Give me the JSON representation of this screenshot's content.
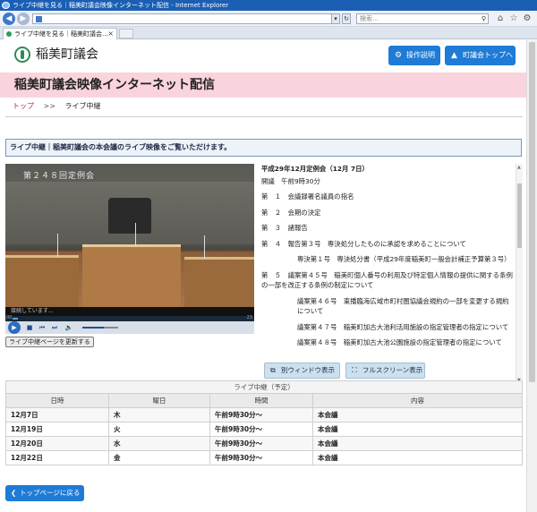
{
  "browser": {
    "title": "ライブ中継を見る｜稲美町議会映像インターネット配信 - Internet Explorer",
    "search_placeholder": "検索...",
    "tab_label": "ライブ中継を見る｜稲美町議会..."
  },
  "header": {
    "site_name": "稲美町議会",
    "help_button": "操作説明",
    "council_top_button": "町議会トップへ"
  },
  "banner": {
    "title": "稲美町議会映像インターネット配信"
  },
  "breadcrumb": {
    "home": "トップ",
    "separator": ">>",
    "current": "ライブ中継"
  },
  "notice": "ライブ中継｜稲美町議会の本会議のライブ映像をご覧いただけます。",
  "player": {
    "caption": "第２４８回定例会",
    "status": "接続しています...",
    "time_left": "00",
    "time_right": "23",
    "volume_level": 0.6,
    "refresh_button": "ライブ中継ページを更新する"
  },
  "agenda": {
    "session_title": "平成29年12月定例会（12月 7日）",
    "opening": "開議　午前9時30分",
    "items": [
      "第　１　会議録署名議員の指名",
      "第　２　会期の決定",
      "第　３　諸報告",
      "第　４　報告第３号　専決処分したものに承認を求めることについて",
      "専決第１号　専決処分書（平成29年度稲美町一般会計補正予算第３号）",
      "第　５　議案第４５号　稲美町個人番号の利用及び特定個人情報の提供に関する条例の一部を改正する条例の制定について",
      "議案第４６号　東播臨海広域市町村圏協議会規約の一部を変更する規約について",
      "議案第４７号　稲美町加古大池利活用施設の指定管理者の指定について",
      "議案第４８号　稲美町加古大池公園施設の指定管理者の指定について"
    ],
    "new_window_button": "別ウィンドウ表示",
    "fullscreen_button": "フルスクリーン表示"
  },
  "schedule": {
    "caption": "ライブ中継（予定）",
    "columns": [
      "日時",
      "曜日",
      "時間",
      "内容"
    ],
    "rows": [
      [
        "12月7日",
        "木",
        "午前9時30分～",
        "本会議"
      ],
      [
        "12月19日",
        "火",
        "午前9時30分～",
        "本会議"
      ],
      [
        "12月20日",
        "水",
        "午前9時30分～",
        "本会議"
      ],
      [
        "12月22日",
        "金",
        "午前9時30分～",
        "本会議"
      ]
    ]
  },
  "footer": {
    "back_to_top": "トップページに戻る"
  },
  "colors": {
    "accent": "#1e7bd6",
    "banner": "#f9d4dc",
    "breadcrumb_link": "#b7245a"
  }
}
